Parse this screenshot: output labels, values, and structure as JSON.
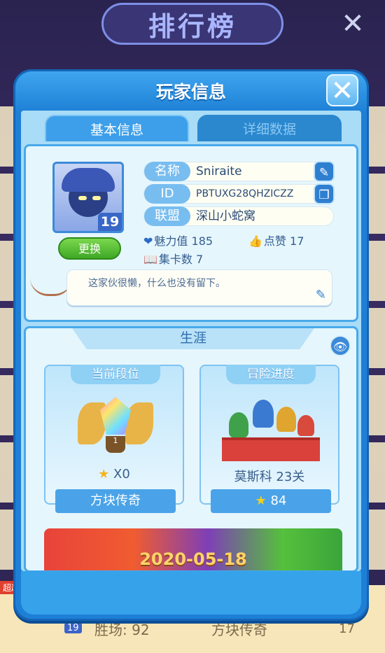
{
  "background": {
    "title": "排行榜",
    "bottom_row": {
      "wins": "胜场: 92",
      "rank": "方块传奇",
      "num": "17",
      "level": "19",
      "tag": "超越"
    }
  },
  "dialog": {
    "title": "玩家信息",
    "tabs": [
      {
        "label": "基本信息",
        "active": true
      },
      {
        "label": "详细数据",
        "active": false
      }
    ],
    "profile": {
      "level": "19",
      "change_label": "更换",
      "fields": [
        {
          "label": "名称",
          "value": "Sniraite"
        },
        {
          "label": "ID",
          "value": "PBTUXG28QHZICZZ"
        },
        {
          "label": "联盟",
          "value": "深山小蛇窝"
        }
      ],
      "charm_label": "魅力值",
      "charm": "185",
      "likes_label": "点赞",
      "likes": "17",
      "cards_label": "集卡数",
      "cards": "7",
      "signature": "这家伙很懒，什么也没有留下。"
    },
    "career": {
      "title": "生涯",
      "rank": {
        "title": "当前段位",
        "stars": "X0",
        "name": "方块传奇"
      },
      "adventure": {
        "title": "冒险进度",
        "progress": "莫斯科 23关",
        "stars": "84"
      },
      "date": "2020-05-18"
    }
  },
  "colors": {
    "accent": "#1e7fd6",
    "green_button": "#3ea825"
  }
}
